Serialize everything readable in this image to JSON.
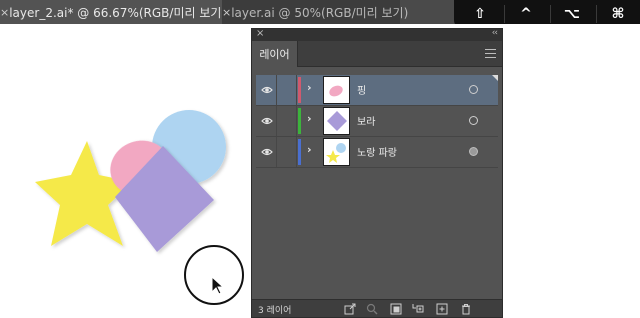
{
  "tabs": [
    {
      "label": "layer_2.ai* @ 66.67%(RGB/미리 보기)",
      "close": "×",
      "active": true
    },
    {
      "label": "layer.ai @ 50%(RGB/미리 보기)",
      "close": "×",
      "active": false
    }
  ],
  "keys": [
    {
      "name": "shift-key",
      "glyph": "⇧"
    },
    {
      "name": "control-key",
      "glyph": "^"
    },
    {
      "name": "option-key",
      "glyph": "⌥"
    },
    {
      "name": "command-key",
      "glyph": "⌘"
    }
  ],
  "artwork": {
    "shapes": [
      {
        "kind": "circle",
        "color": "#aed4f1"
      },
      {
        "kind": "star",
        "color": "#f5e94a"
      },
      {
        "kind": "pink-ellipse",
        "color": "#f2a8c2"
      },
      {
        "kind": "diamond",
        "color": "#a89ad8"
      }
    ]
  },
  "panel": {
    "close": "×",
    "collapse": "‹‹",
    "tab_label": "레이어",
    "menu_icon": "hamburger-icon",
    "footer_count": "3 레이어",
    "layers": [
      {
        "name": "핑",
        "color": "#d05a6e",
        "selected": true,
        "target_filled": false
      },
      {
        "name": "보라",
        "color": "#3cb43c",
        "selected": false,
        "target_filled": false
      },
      {
        "name": "노랑 파랑",
        "color": "#4a6fd0",
        "selected": false,
        "target_filled": true
      }
    ],
    "footer_icons": [
      "export-icon",
      "search-icon",
      "clipping-mask-icon",
      "new-sublayer-icon",
      "new-layer-icon",
      "trash-icon"
    ]
  },
  "colors": {
    "tab_active": "#535353",
    "panel_bg": "#535353",
    "selected_row": "#5d6d80"
  }
}
